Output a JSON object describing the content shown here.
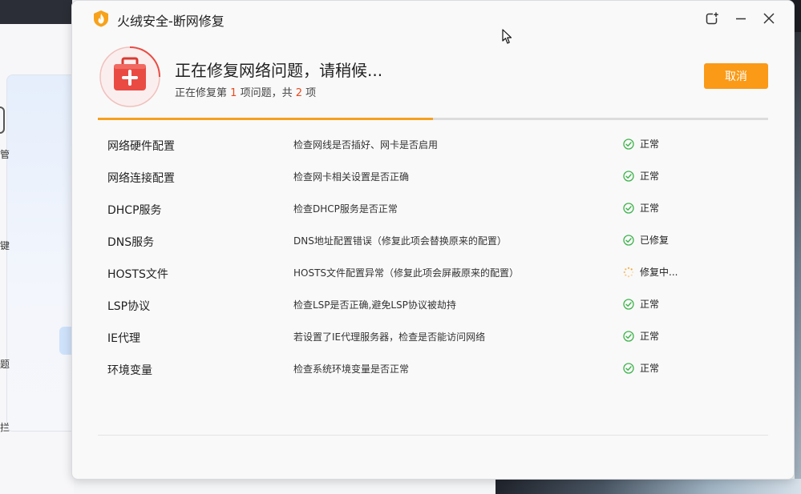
{
  "window": {
    "title": "火绒安全-断网修复"
  },
  "background_window": {
    "fragments": [
      "管",
      "键",
      "题",
      "拦"
    ]
  },
  "header": {
    "status_title": "正在修复网络问题，请稍候...",
    "status_sub_prefix": "正在修复第",
    "current_index": "1",
    "status_sub_middle": "项问题，共",
    "total_count": "2",
    "status_sub_suffix": "项",
    "cancel_label": "取消"
  },
  "progress": {
    "fraction": 0.5
  },
  "items": [
    {
      "name": "网络硬件配置",
      "desc": "检查网线是否插好、网卡是否启用",
      "status": "正常",
      "state": "ok"
    },
    {
      "name": "网络连接配置",
      "desc": "检查网卡相关设置是否正确",
      "status": "正常",
      "state": "ok"
    },
    {
      "name": "DHCP服务",
      "desc": "检查DHCP服务是否正常",
      "status": "正常",
      "state": "ok"
    },
    {
      "name": "DNS服务",
      "desc": "DNS地址配置错误（修复此项会替换原来的配置）",
      "status": "已修复",
      "state": "ok"
    },
    {
      "name": "HOSTS文件",
      "desc": "HOSTS文件配置异常（修复此项会屏蔽原来的配置）",
      "status": "修复中...",
      "state": "loading"
    },
    {
      "name": "LSP协议",
      "desc": "检查LSP是否正确,避免LSP协议被劫持",
      "status": "正常",
      "state": "ok"
    },
    {
      "name": "IE代理",
      "desc": "若设置了IE代理服务器，检查是否能访问网络",
      "status": "正常",
      "state": "ok"
    },
    {
      "name": "环境变量",
      "desc": "检查系统环境变量是否正常",
      "status": "正常",
      "state": "ok"
    }
  ],
  "colors": {
    "accent_orange": "#fa9a17",
    "ok_green": "#3cb34a",
    "highlight_red": "#e8491d",
    "icon_red": "#e94b43"
  }
}
